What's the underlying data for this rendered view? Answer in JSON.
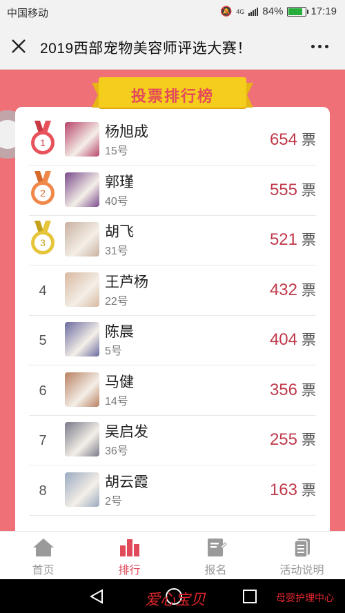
{
  "status_bar": {
    "carrier": "中国移动",
    "network": "4G",
    "battery": "84%",
    "battery_level": 0.84,
    "time": "17:19"
  },
  "title_bar": {
    "title": "2019西部宠物美容师评选大赛！",
    "close_icon": "close-icon",
    "more_icon": "more-dots-icon"
  },
  "header": {
    "ribbon_text": "投票排行榜"
  },
  "leaderboard": [
    {
      "rank": "1",
      "medal": "red",
      "name": "杨旭成",
      "number": "15号",
      "votes": "654",
      "unit": "票",
      "thumb": "grooming-photo"
    },
    {
      "rank": "2",
      "medal": "orange",
      "name": "郭瑾",
      "number": "40号",
      "votes": "555",
      "unit": "票",
      "thumb": "grooming-photo"
    },
    {
      "rank": "3",
      "medal": "yellow",
      "name": "胡飞",
      "number": "31号",
      "votes": "521",
      "unit": "票",
      "thumb": "grooming-photo"
    },
    {
      "rank": "4",
      "name": "王芦杨",
      "number": "22号",
      "votes": "432",
      "unit": "票",
      "thumb": "grooming-photo"
    },
    {
      "rank": "5",
      "name": "陈晨",
      "number": "5号",
      "votes": "404",
      "unit": "票",
      "thumb": "grooming-photo"
    },
    {
      "rank": "6",
      "name": "马健",
      "number": "14号",
      "votes": "356",
      "unit": "票",
      "thumb": "grooming-photo"
    },
    {
      "rank": "7",
      "name": "吴启发",
      "number": "36号",
      "votes": "255",
      "unit": "票",
      "thumb": "grooming-photo"
    },
    {
      "rank": "8",
      "name": "胡云霞",
      "number": "2号",
      "votes": "163",
      "unit": "票",
      "thumb": "grooming-photo"
    }
  ],
  "tabs": [
    {
      "label": "首页",
      "icon": "home-icon",
      "active": false
    },
    {
      "label": "排行",
      "icon": "bar-chart-icon",
      "active": true
    },
    {
      "label": "报名",
      "icon": "edit-icon",
      "active": false
    },
    {
      "label": "活动说明",
      "icon": "document-icon",
      "active": false
    }
  ],
  "watermark": {
    "left": "爱心宝贝",
    "right": "母婴护理中心"
  },
  "colors": {
    "page_bg": "#f07078",
    "ribbon": "#f5cd1d",
    "accent": "#e04a5a",
    "votes": "#c0394b"
  }
}
